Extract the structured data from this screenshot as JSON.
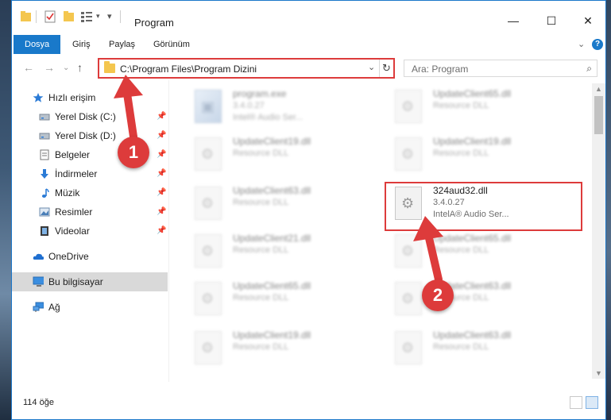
{
  "window": {
    "title": "Program"
  },
  "window_controls": {
    "minimize": "—",
    "maximize": "☐",
    "close": "✕"
  },
  "ribbon": {
    "tabs": [
      "Dosya",
      "Giriş",
      "Paylaş",
      "Görünüm"
    ],
    "help": "?",
    "collapse": "⌄"
  },
  "address": {
    "path": "C:\\Program Files\\Program Dizini",
    "back": "←",
    "forward": "→",
    "recent": "⌄",
    "up": "↑",
    "dropdown": "⌄",
    "refresh": "↻"
  },
  "search": {
    "placeholder": "Ara: Program",
    "icon": "⌕"
  },
  "nav": {
    "quick_access": "Hızlı erişim",
    "items": [
      {
        "label": "Yerel Disk (C:)",
        "icon": "drive-icon",
        "pinned": true
      },
      {
        "label": "Yerel Disk (D:)",
        "icon": "drive-icon",
        "pinned": true
      },
      {
        "label": "Belgeler",
        "icon": "document-icon",
        "pinned": true
      },
      {
        "label": "İndirmeler",
        "icon": "download-icon",
        "pinned": true
      },
      {
        "label": "Müzik",
        "icon": "music-icon",
        "pinned": true
      },
      {
        "label": "Resimler",
        "icon": "pictures-icon",
        "pinned": true
      },
      {
        "label": "Videolar",
        "icon": "video-icon",
        "pinned": true
      }
    ],
    "onedrive": "OneDrive",
    "this_pc": "Bu bilgisayar",
    "network": "Ağ",
    "pin_glyph": "📌"
  },
  "files": [
    {
      "name": "program.exe",
      "line1": "3.4.0.27",
      "line2": "Intel® Audio Ser...",
      "blur": true,
      "kind": "exe"
    },
    {
      "name": "UpdateClient65.dll",
      "line1": "Resource DLL",
      "line2": "",
      "blur": true,
      "kind": "dll"
    },
    {
      "name": "UpdateClient19.dll",
      "line1": "Resource DLL",
      "line2": "",
      "blur": true,
      "kind": "dll"
    },
    {
      "name": "UpdateClient19.dll",
      "line1": "Resource DLL",
      "line2": "",
      "blur": true,
      "kind": "dll"
    },
    {
      "name": "UpdateClient63.dll",
      "line1": "Resource DLL",
      "line2": "",
      "blur": true,
      "kind": "dll"
    },
    {
      "name": "324aud32.dll",
      "line1": "3.4.0.27",
      "line2": "IntelA® Audio Ser...",
      "blur": false,
      "kind": "dll"
    },
    {
      "name": "UpdateClient21.dll",
      "line1": "Resource DLL",
      "line2": "",
      "blur": true,
      "kind": "dll"
    },
    {
      "name": "UpdateClient65.dll",
      "line1": "Resource DLL",
      "line2": "",
      "blur": true,
      "kind": "dll"
    },
    {
      "name": "UpdateClient65.dll",
      "line1": "Resource DLL",
      "line2": "",
      "blur": true,
      "kind": "dll"
    },
    {
      "name": "UpdateClient63.dll",
      "line1": "Resource DLL",
      "line2": "",
      "blur": true,
      "kind": "dll"
    },
    {
      "name": "UpdateClient19.dll",
      "line1": "Resource DLL",
      "line2": "",
      "blur": true,
      "kind": "dll"
    },
    {
      "name": "UpdateClient63.dll",
      "line1": "Resource DLL",
      "line2": "",
      "blur": true,
      "kind": "dll"
    }
  ],
  "status": {
    "count": "114 öğe"
  },
  "annotations": [
    {
      "label": "1",
      "color": "#dd3b3b"
    },
    {
      "label": "2",
      "color": "#dd3b3b"
    }
  ],
  "colors": {
    "accent": "#1979ca",
    "highlight": "#dd3b3b",
    "selected": "#d9d9d9"
  }
}
